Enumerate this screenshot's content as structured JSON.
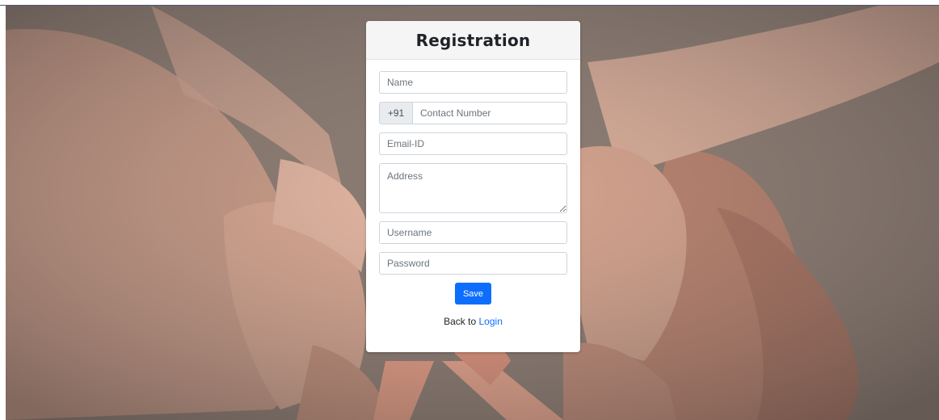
{
  "form": {
    "title": "Registration",
    "name_placeholder": "Name",
    "country_code": "+91",
    "contact_placeholder": "Contact Number",
    "email_placeholder": "Email-ID",
    "address_placeholder": "Address",
    "username_placeholder": "Username",
    "password_placeholder": "Password",
    "save_label": "Save",
    "back_text": "Back to",
    "login_link": "Login"
  },
  "colors": {
    "primary": "#0d6efd",
    "ribbon": "#f0a085"
  }
}
